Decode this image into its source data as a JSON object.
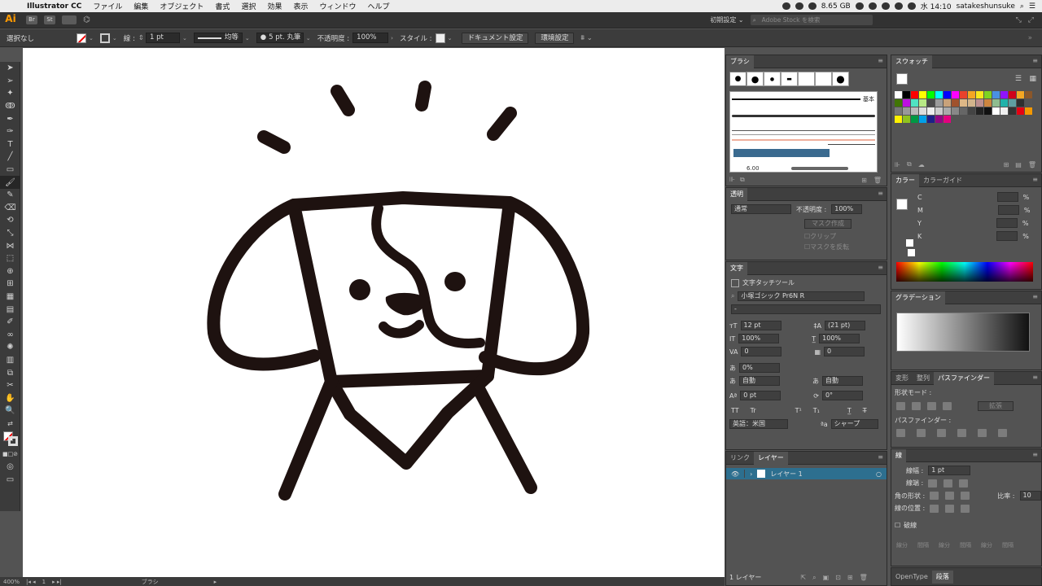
{
  "menubar": {
    "app": "Illustrator CC",
    "items": [
      "ファイル",
      "編集",
      "オブジェクト",
      "書式",
      "選択",
      "効果",
      "表示",
      "ウィンドウ",
      "ヘルプ"
    ],
    "memory": "8.65 GB",
    "time": "水 14:10",
    "user": "satakeshunsuke"
  },
  "appbar": {
    "logo": "Ai",
    "bridge": "Br",
    "stock": "St",
    "workspace": "初期設定",
    "search_placeholder": "Adobe Stock を検索"
  },
  "control": {
    "selection": "選択なし",
    "stroke_label": "線 :",
    "stroke_weight": "1 pt",
    "profile": "均等",
    "brush": "5 pt. 丸筆",
    "opacity_label": "不透明度 :",
    "opacity": "100%",
    "style_label": "スタイル :",
    "doc_settings": "ドキュメント設定",
    "prefs": "環境設定"
  },
  "status": {
    "zoom": "400%",
    "page": "1",
    "tool": "ブラシ"
  },
  "brush_panel": {
    "tab": "ブラシ",
    "basic_label": "基本",
    "size_value": "6.00"
  },
  "transparency": {
    "tab": "透明",
    "mode": "通常",
    "opacity_label": "不透明度 :",
    "opacity": "100%",
    "make_mask": "マスク作成",
    "clip": "クリップ",
    "invert": "マスクを反転"
  },
  "character": {
    "tab": "文字",
    "touch_tool": "文字タッチツール",
    "font": "小塚ゴシック Pr6N R",
    "style": "-",
    "size": "12 pt",
    "leading": "(21 pt)",
    "vscale": "100%",
    "hscale": "100%",
    "kerning": "0",
    "tracking": "0",
    "tsume": "0%",
    "aki_left": "自動",
    "aki_right": "自動",
    "baseline": "0 pt",
    "rotation": "0°",
    "language": "英語：米国",
    "antialias": "シャープ"
  },
  "layers": {
    "tabs": [
      "リンク",
      "レイヤー"
    ],
    "layer_name": "レイヤー 1",
    "count": "1 レイヤー"
  },
  "swatches": {
    "tab": "スウォッチ"
  },
  "color": {
    "tabs": [
      "カラー",
      "カラーガイド"
    ],
    "labels": [
      "C",
      "M",
      "Y",
      "K"
    ],
    "unit": "%"
  },
  "gradient": {
    "tab": "グラデーション"
  },
  "pathfinder": {
    "tabs": [
      "変形",
      "整列",
      "パスファインダー"
    ],
    "shape_mode": "形状モード :",
    "expand": "拡張",
    "pathfinder_label": "パスファインダー :"
  },
  "stroke": {
    "tab": "線",
    "weight_label": "線幅 :",
    "weight": "1 pt",
    "cap_label": "線端 :",
    "corner_label": "角の形状 :",
    "ratio_label": "比率 :",
    "ratio": "10",
    "align_label": "線の位置 :",
    "dashed": "破線",
    "dash_labels": [
      "線分",
      "間隔",
      "線分",
      "間隔",
      "線分",
      "間隔"
    ]
  },
  "bottom_tabs": [
    "OpenType",
    "段落"
  ],
  "colors": {
    "panel": "#535353",
    "dark": "#323232",
    "accent": "#ff9a00",
    "ink": "#1e1210",
    "layer_sel": "#2d6f8f"
  }
}
